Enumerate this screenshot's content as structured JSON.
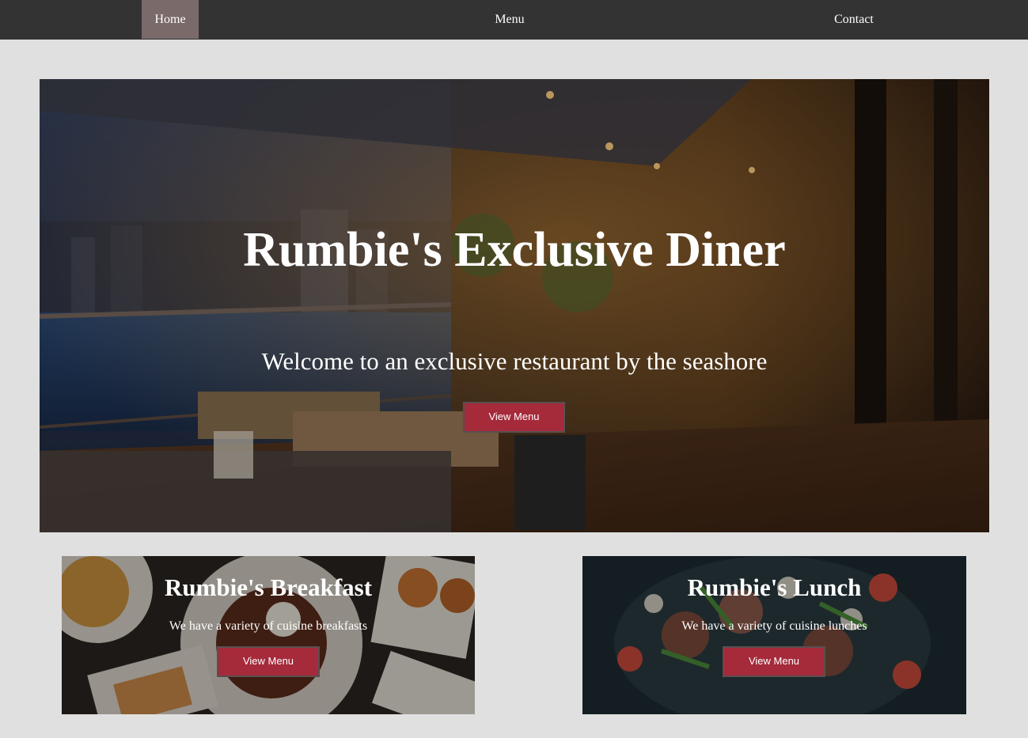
{
  "nav": {
    "items": [
      {
        "label": "Home",
        "active": true
      },
      {
        "label": "Menu",
        "active": false
      },
      {
        "label": "Contact",
        "active": false
      }
    ]
  },
  "hero": {
    "title": "Rumbie's Exclusive Diner",
    "subtitle": "Welcome to an exclusive restaurant by the seashore",
    "button_label": "View Menu"
  },
  "cards": [
    {
      "title": "Rumbie's Breakfast",
      "text": "We have a variety of cuisine breakfasts",
      "button_label": "View Menu"
    },
    {
      "title": "Rumbie's Lunch",
      "text": "We have a variety of cuisine lunches",
      "button_label": "View Menu"
    }
  ],
  "colors": {
    "nav_bg": "#333333",
    "nav_active": "#7a6a6a",
    "page_bg": "#e0e0e0",
    "button_bg": "#a52a3a"
  }
}
